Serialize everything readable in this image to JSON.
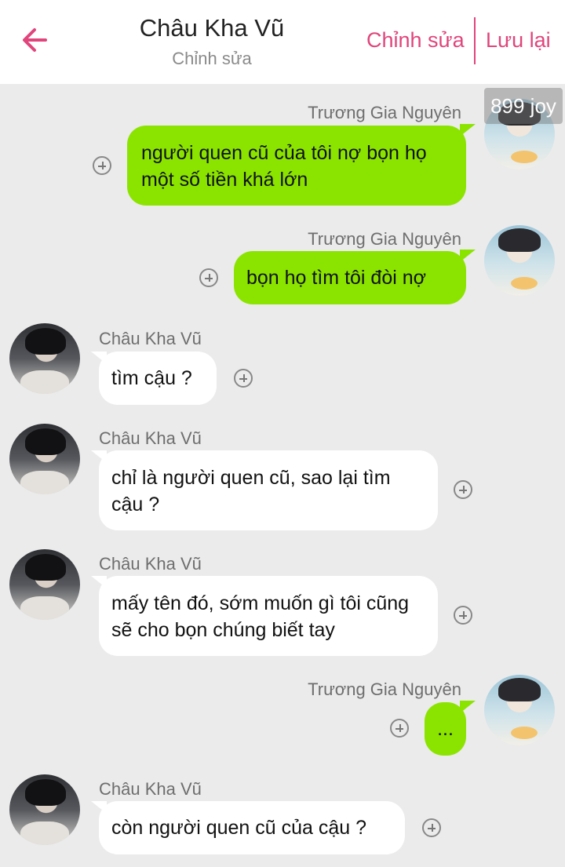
{
  "header": {
    "title": "Châu Kha Vũ",
    "subtitle": "Chỉnh sửa",
    "edit_label": "Chỉnh sửa",
    "save_label": "Lưu lại",
    "accent_color": "#e0457b"
  },
  "watermark": "899 joy",
  "messages": [
    {
      "sender": "Trương Gia Nguyên",
      "side": "right",
      "text": "người quen cũ của tôi nợ bọn họ một số tiền khá lớn"
    },
    {
      "sender": "Trương Gia Nguyên",
      "side": "right",
      "text": "bọn họ tìm tôi đòi nợ"
    },
    {
      "sender": "Châu Kha Vũ",
      "side": "left",
      "text": "tìm cậu ?"
    },
    {
      "sender": "Châu Kha Vũ",
      "side": "left",
      "text": "chỉ là người quen cũ, sao lại tìm cậu ?"
    },
    {
      "sender": "Châu Kha Vũ",
      "side": "left",
      "text": "mấy tên đó, sớm muốn gì tôi cũng sẽ cho bọn chúng biết tay"
    },
    {
      "sender": "Trương Gia Nguyên",
      "side": "right",
      "text": "..."
    },
    {
      "sender": "Châu Kha Vũ",
      "side": "left",
      "text": "còn người quen cũ của cậu ?"
    }
  ],
  "colors": {
    "outgoing_bubble": "#8be400",
    "incoming_bubble": "#ffffff",
    "background": "#ebebeb"
  },
  "icons": {
    "back": "arrow-left-icon",
    "add": "plus-circle-icon"
  }
}
